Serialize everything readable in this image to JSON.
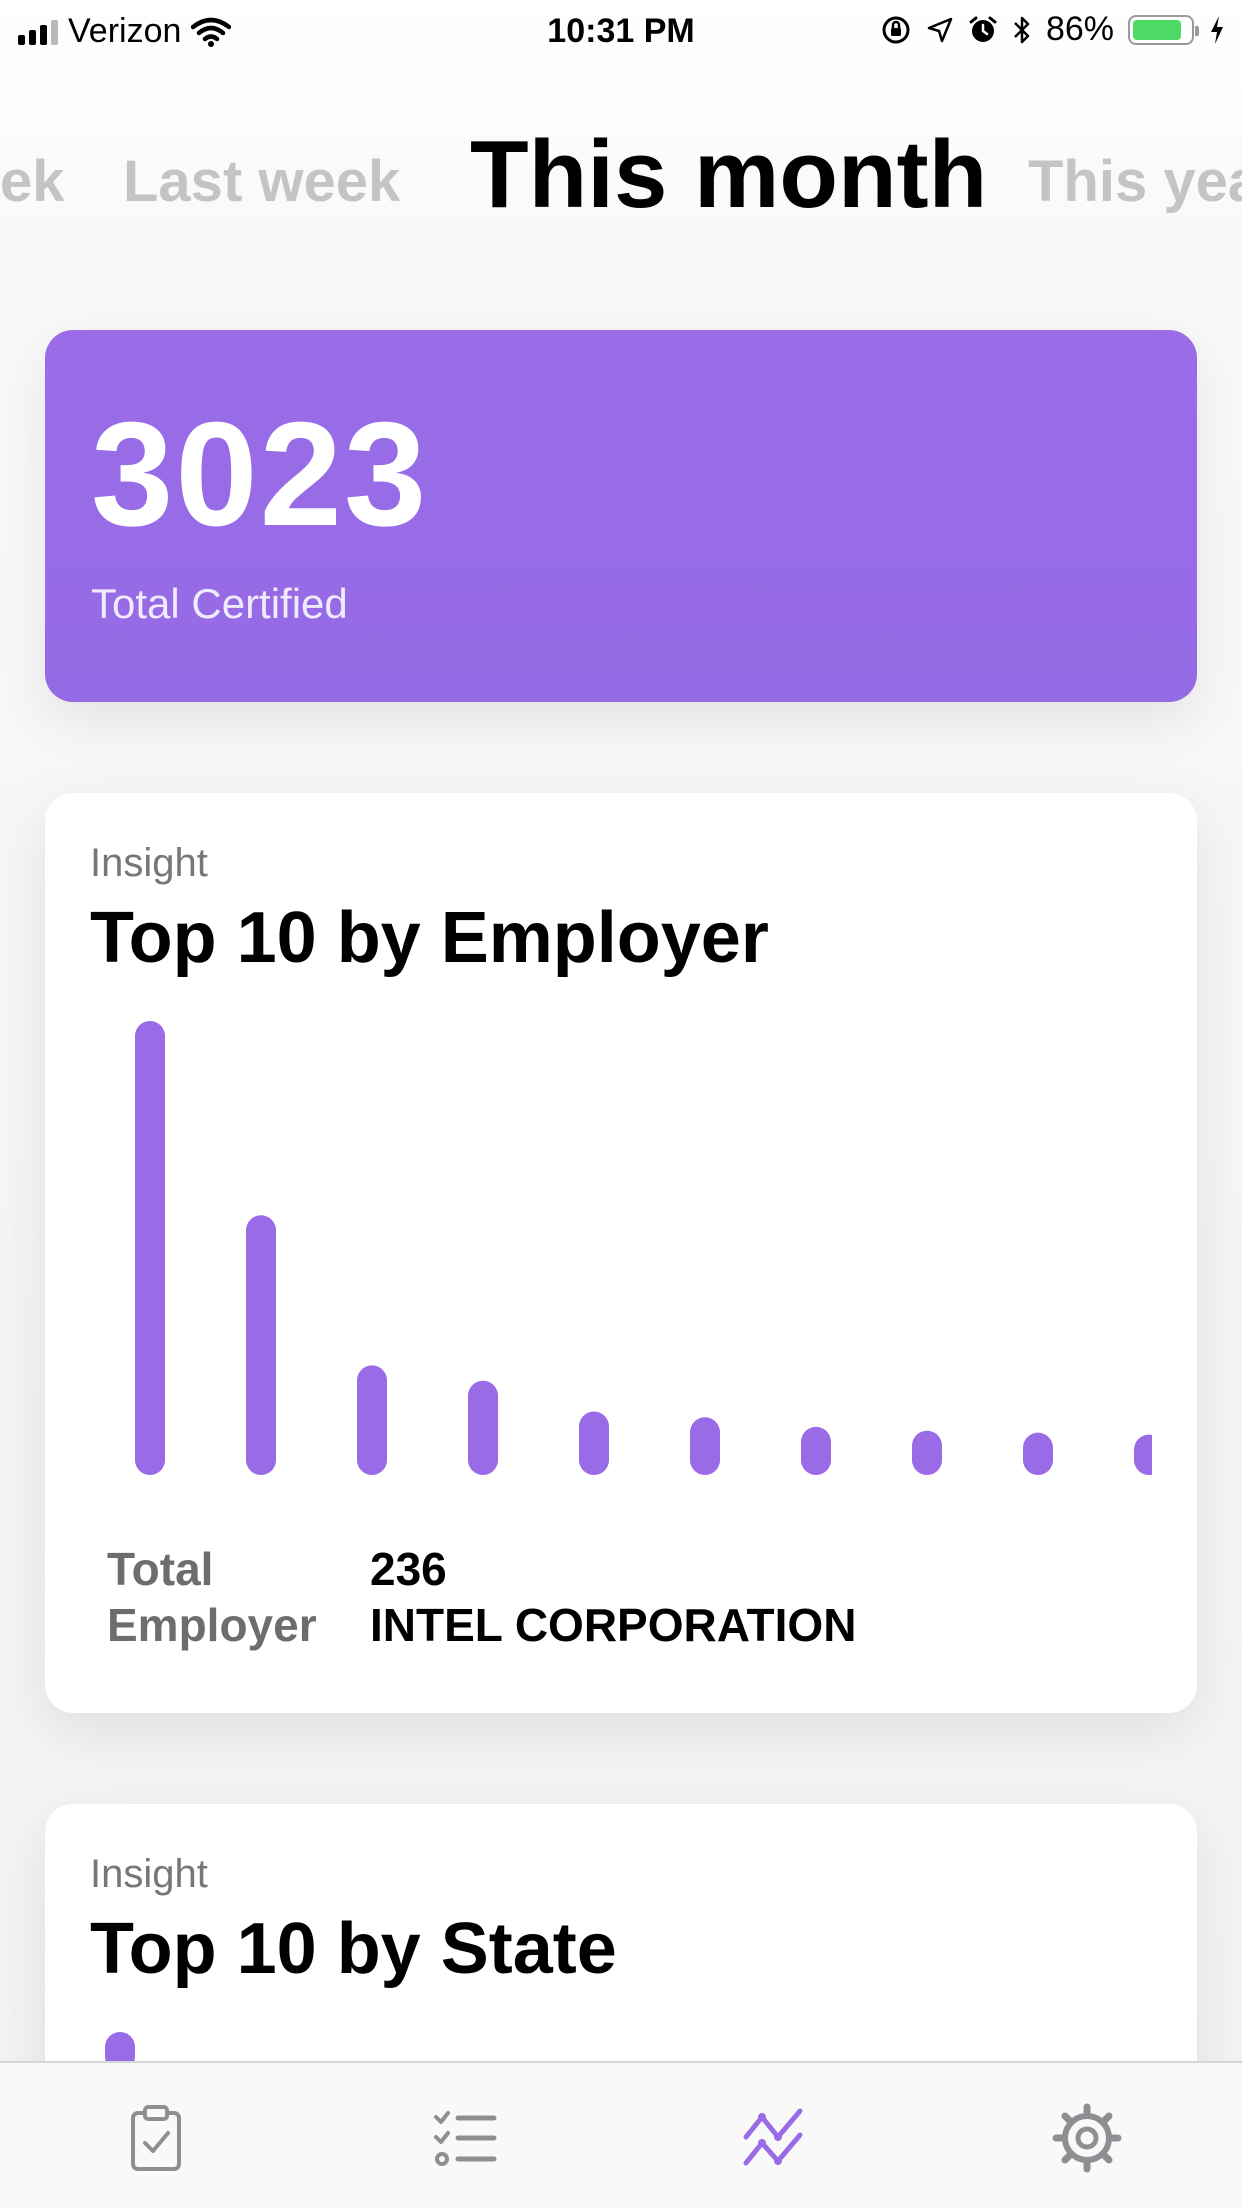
{
  "status_bar": {
    "carrier": "Verizon",
    "time": "10:31 PM",
    "battery_percent": "86%",
    "battery_level": 0.86,
    "icons": [
      "signal-icon",
      "wifi-icon",
      "rotation-lock-icon",
      "location-icon",
      "alarm-icon",
      "bluetooth-icon",
      "battery-icon",
      "charging-icon"
    ]
  },
  "period_tabs": [
    {
      "label": "ek",
      "active": false
    },
    {
      "label": "Last week",
      "active": false
    },
    {
      "label": "This month",
      "active": true
    },
    {
      "label": "This yea",
      "active": false
    }
  ],
  "summary": {
    "value": "3023",
    "label": "Total Certified"
  },
  "employer_insight": {
    "kicker": "Insight",
    "title": "Top 10 by Employer",
    "total_label_line1": "Total",
    "total_label_line2": "Employer",
    "total_value": "236",
    "employer_name": "INTEL CORPORATION"
  },
  "state_insight": {
    "kicker": "Insight",
    "title": "Top 10 by State"
  },
  "chart_data": {
    "type": "bar",
    "categories": [],
    "values": [
      236,
      135,
      57,
      49,
      33,
      30,
      25,
      23,
      22,
      21
    ],
    "ylim": [
      0,
      236
    ],
    "grid": false,
    "bar_color": "#9a6be6"
  },
  "tab_bar": {
    "items": [
      {
        "icon": "clipboard-check-icon",
        "active": false
      },
      {
        "icon": "checklist-icon",
        "active": false
      },
      {
        "icon": "insights-chart-icon",
        "active": true
      },
      {
        "icon": "gear-icon",
        "active": false
      }
    ],
    "active_color": "#9a6be6",
    "inactive_color": "#8e8e93"
  },
  "colors": {
    "accent": "#9a6be6",
    "hero_background": "#996ce7"
  }
}
